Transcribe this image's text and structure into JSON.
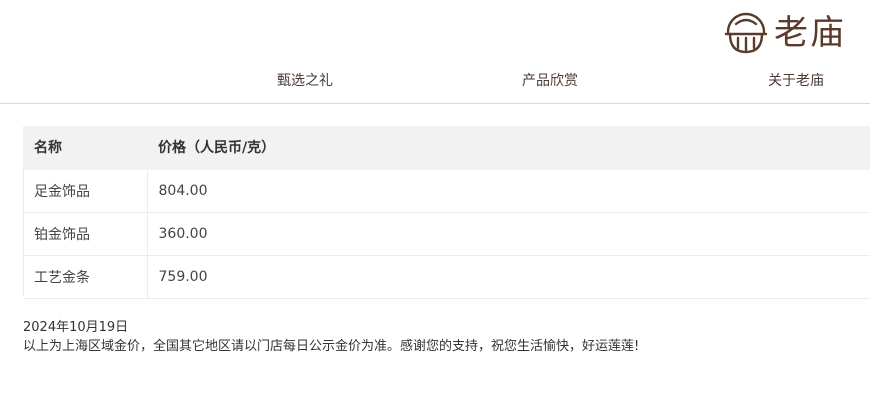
{
  "brand": {
    "name": "老庙",
    "icon": "laomiao-logo-icon",
    "color": "#5a3a2c"
  },
  "nav": {
    "items": [
      {
        "label": "甄选之礼"
      },
      {
        "label": "产品欣赏"
      },
      {
        "label": "关于老庙"
      }
    ]
  },
  "price_table": {
    "headers": {
      "name": "名称",
      "price": "价格（人民币/克）"
    },
    "rows": [
      {
        "name": "足金饰品",
        "price": "804.00"
      },
      {
        "name": "铂金饰品",
        "price": "360.00"
      },
      {
        "name": "工艺金条",
        "price": "759.00"
      }
    ]
  },
  "notice": {
    "date": "2024年10月19日",
    "text": "以上为上海区域金价，全国其它地区请以门店每日公示金价为准。感谢您的支持，祝您生活愉快，好运莲莲!"
  }
}
